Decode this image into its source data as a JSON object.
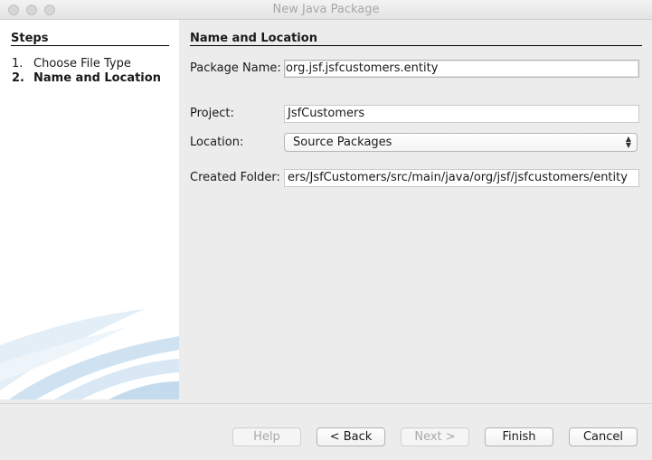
{
  "window": {
    "title": "New Java Package"
  },
  "steps": {
    "heading": "Steps",
    "items": [
      {
        "num": "1.",
        "label": "Choose File Type"
      },
      {
        "num": "2.",
        "label": "Name and Location"
      }
    ]
  },
  "main": {
    "heading": "Name and Location",
    "package_name": {
      "label": "Package Name:",
      "value": "org.jsf.jsfcustomers.entity"
    },
    "project": {
      "label": "Project:",
      "value": "JsfCustomers"
    },
    "location": {
      "label": "Location:",
      "value": "Source Packages"
    },
    "created_folder": {
      "label": "Created Folder:",
      "value": "ers/JsfCustomers/src/main/java/org/jsf/jsfcustomers/entity"
    }
  },
  "buttons": {
    "help": "Help",
    "back": "< Back",
    "next": "Next >",
    "finish": "Finish",
    "cancel": "Cancel"
  },
  "colors": {
    "panel_bg": "#ffffff",
    "window_bg": "#ececec",
    "swoosh": "#c8deef"
  }
}
